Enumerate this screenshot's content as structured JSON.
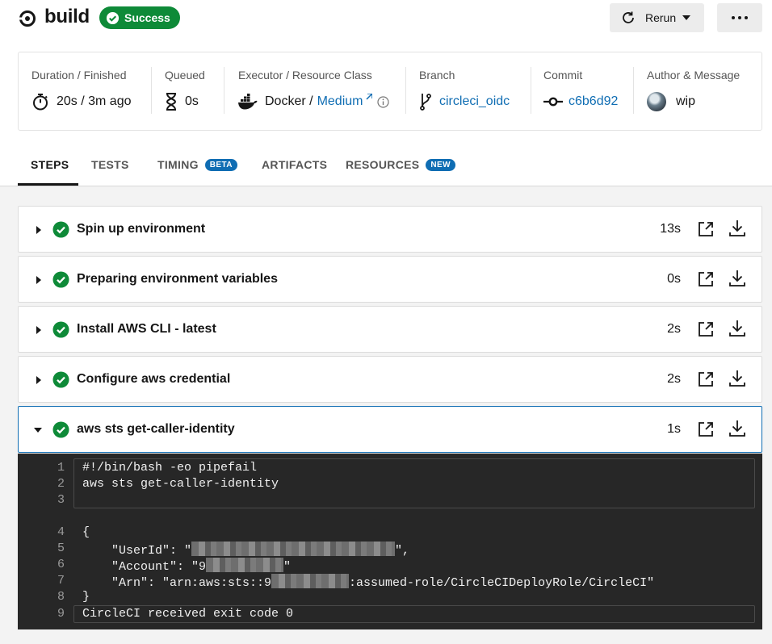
{
  "header": {
    "title": "build",
    "status": "Success",
    "rerun_label": "Rerun"
  },
  "info": {
    "duration_label": "Duration / Finished",
    "duration_value": "20s / 3m ago",
    "queued_label": "Queued",
    "queued_value": "0s",
    "executor_label": "Executor / Resource Class",
    "executor_value": "Docker /",
    "resource_class": "Medium",
    "branch_label": "Branch",
    "branch_value": "circleci_oidc",
    "commit_label": "Commit",
    "commit_value": "c6b6d92",
    "author_label": "Author & Message",
    "author_message": "wip"
  },
  "tabs": {
    "steps": "STEPS",
    "tests": "TESTS",
    "timing": "TIMING",
    "timing_badge": "BETA",
    "artifacts": "ARTIFACTS",
    "resources": "RESOURCES",
    "resources_badge": "NEW"
  },
  "steps": [
    {
      "title": "Spin up environment",
      "duration": "13s"
    },
    {
      "title": "Preparing environment variables",
      "duration": "0s"
    },
    {
      "title": "Install AWS CLI - latest",
      "duration": "2s"
    },
    {
      "title": "Configure aws credential",
      "duration": "2s"
    },
    {
      "title": "aws sts get-caller-identity",
      "duration": "1s"
    }
  ],
  "console": {
    "line_numbers": [
      "1",
      "2",
      "3",
      "4",
      "5",
      "6",
      "7",
      "8",
      "9"
    ],
    "l1": "#!/bin/bash -eo pipefail",
    "l2": "aws sts get-caller-identity",
    "l4": "{",
    "l5_a": "    \"UserId\": \"",
    "l5_b": "\",",
    "l6_a": "    \"Account\": \"9",
    "l6_b": "\"",
    "l7_a": "    \"Arn\": \"arn:aws:sts::9",
    "l7_b": ":assumed-role/CircleCIDeployRole/CircleCI\"",
    "l8": "}",
    "l9": "CircleCI received exit code 0"
  },
  "colors": {
    "success": "#0e8a38",
    "link": "#0f6db3",
    "console_bg": "#272727"
  }
}
